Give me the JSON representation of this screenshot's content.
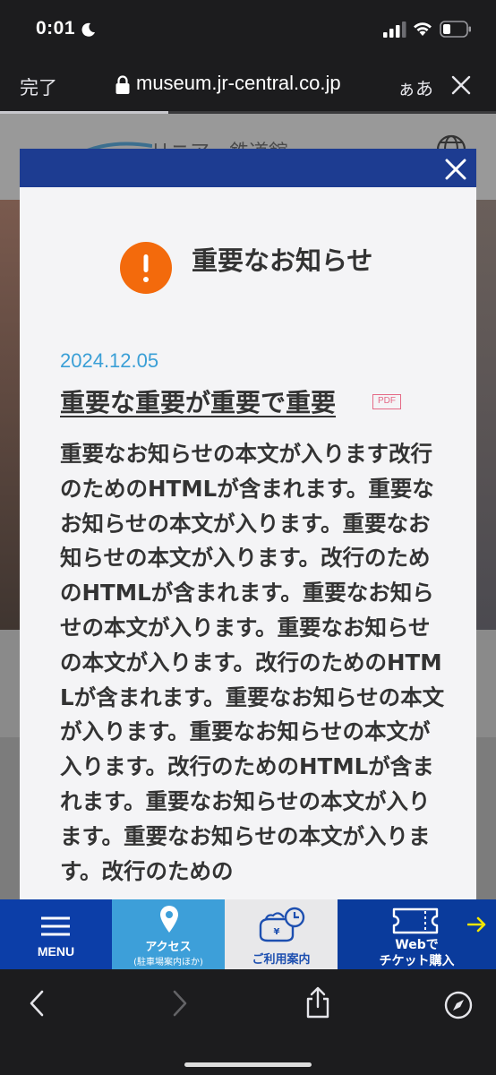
{
  "status_bar": {
    "time": "0:01"
  },
  "browser": {
    "done_label": "完了",
    "url": "museum.jr-central.co.jp",
    "reader_label": "ぁあ",
    "load_progress": 0.34
  },
  "page": {
    "logo_text": "リニア・鉄道館"
  },
  "modal": {
    "title": "重要なお知らせ",
    "date": "2024.12.05",
    "news_title": "重要な重要が重要で重要",
    "pdf_badge": "PDF",
    "body": "重要なお知らせの本文が入ります改行のためのHTMLが含まれます。重要なお知らせの本文が入ります。重要なお知らせの本文が入ります。改行のためのHTMLが含まれます。重要なお知らせの本文が入ります。重要なお知らせの本文が入ります。改行のためのHTMLが含まれます。重要なお知らせの本文が入ります。重要なお知らせの本文が入ります。改行のためのHTMLが含まれます。重要なお知らせの本文が入ります。重要なお知らせの本文が入ります。改行のための"
  },
  "site_nav": {
    "menu": "MENU",
    "access": "アクセス",
    "access_sub": "(駐車場案内ほか)",
    "guide": "ご利用案内",
    "ticket_line1": "Webで",
    "ticket_line2": "チケット購入"
  },
  "colors": {
    "modal_bar": "#1d3c91",
    "alert": "#f36a0c",
    "date": "#3a9fd6",
    "pdf": "#e46a86",
    "nav_menu": "#0c3ea8",
    "nav_access": "#3d9fd9",
    "nav_ticket": "#0a3b9c",
    "ticket_arrow": "#f2e600"
  }
}
